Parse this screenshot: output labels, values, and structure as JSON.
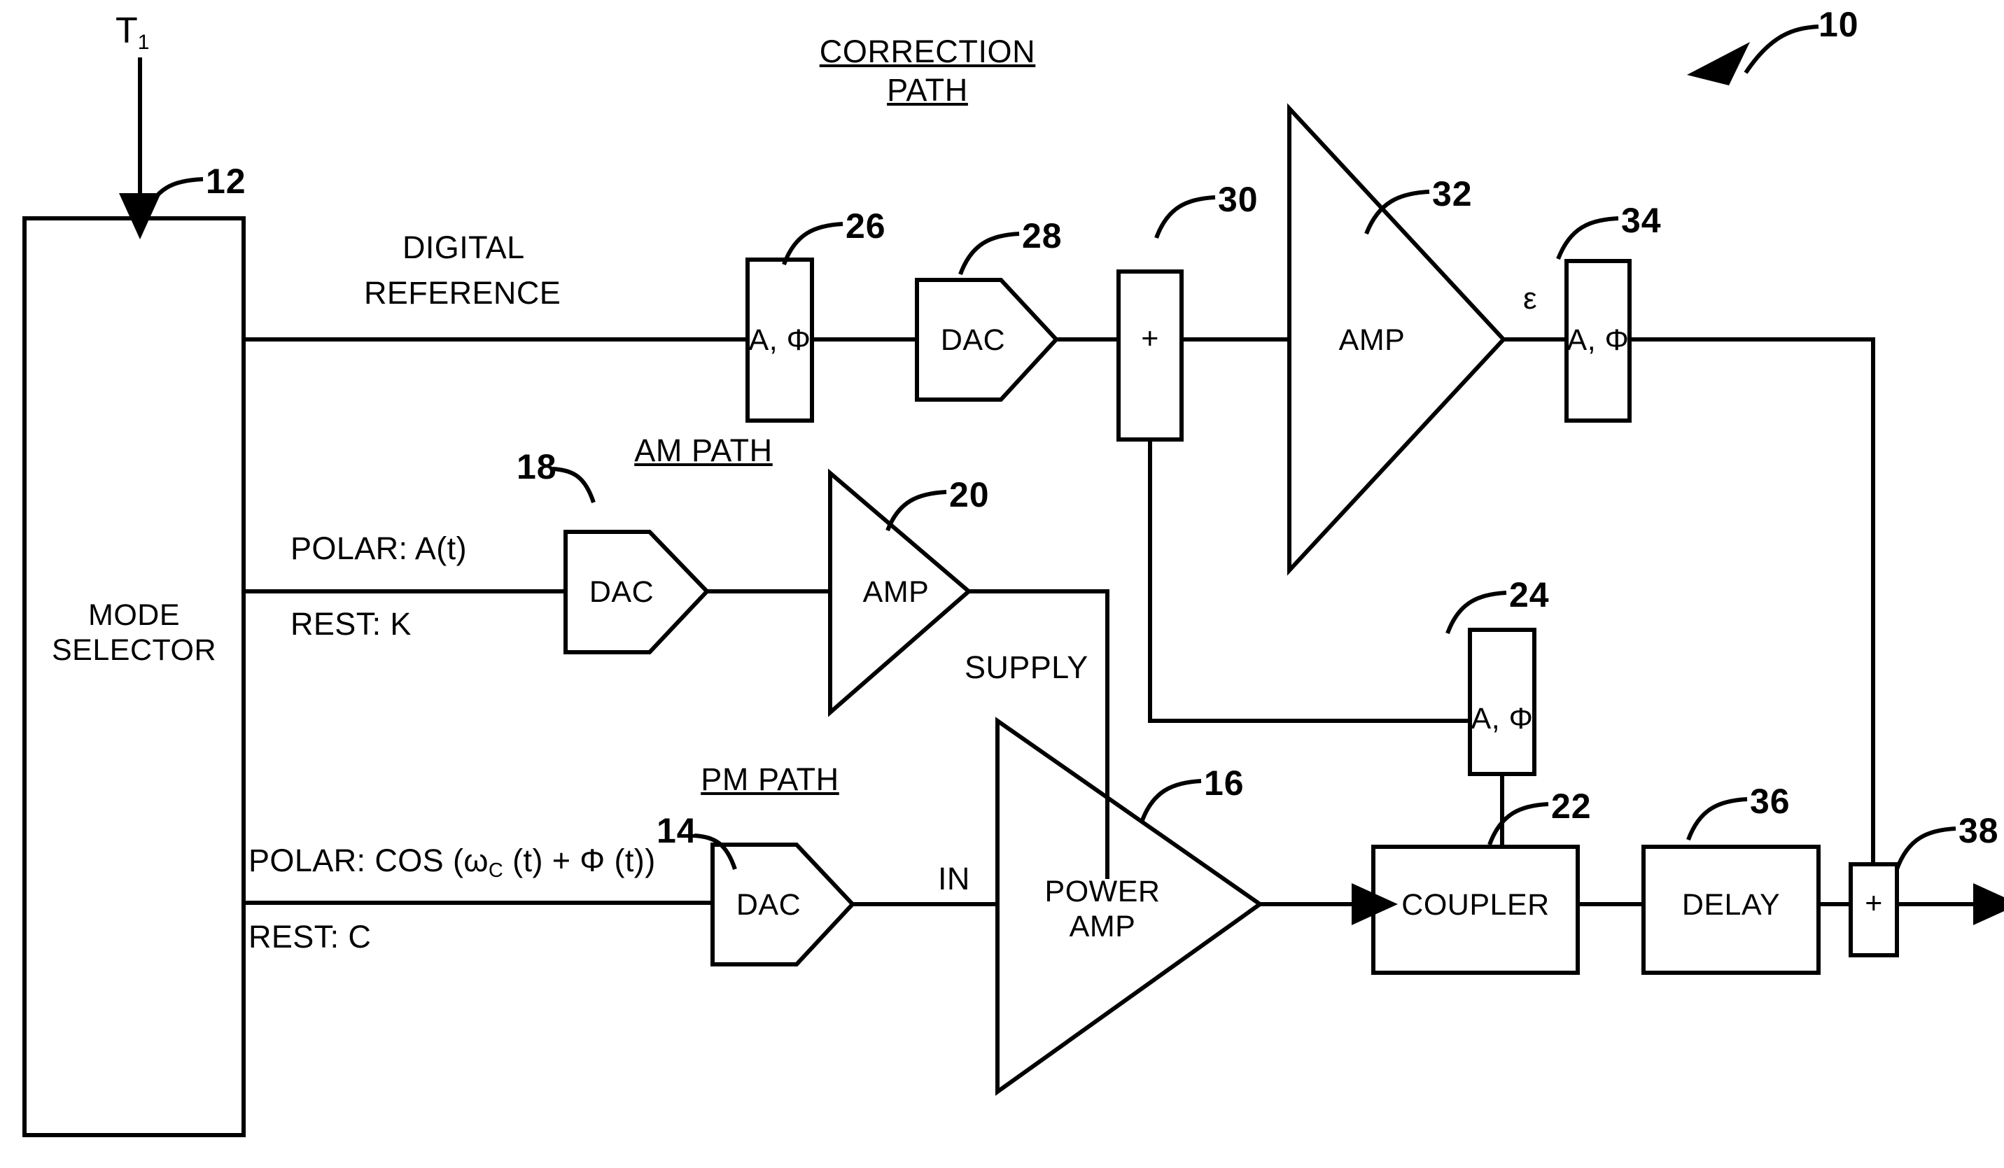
{
  "figure": {
    "reference_number": "10",
    "input_signal_label": "T",
    "input_signal_subscript": "1",
    "headings": {
      "correction_path_line1": "CORRECTION",
      "correction_path_line2": "PATH",
      "am_path": "AM PATH",
      "pm_path": "PM PATH"
    },
    "signal_labels": {
      "digital_reference_line1": "DIGITAL",
      "digital_reference_line2": "REFERENCE",
      "am_polar": "POLAR: A(t)",
      "am_rest": "REST: K",
      "pm_polar_prefix": "POLAR: COS (ω",
      "pm_polar_sub": "C",
      "pm_polar_suffix": " (t) + Φ (t))",
      "pm_rest": "REST: C",
      "supply": "SUPPLY",
      "power_amp_in": "IN",
      "error": "ε"
    },
    "blocks": [
      {
        "id": "12",
        "name": "mode-selector",
        "shape": "rect",
        "label_line1": "MODE",
        "label_line2": "SELECTOR"
      },
      {
        "id": "26",
        "name": "correction-a-phi",
        "shape": "rect",
        "label_line1": "A, Φ"
      },
      {
        "id": "28",
        "name": "correction-dac",
        "shape": "pentagon",
        "label_line1": "DAC"
      },
      {
        "id": "30",
        "name": "correction-summer",
        "shape": "rect",
        "label_line1": "+"
      },
      {
        "id": "32",
        "name": "correction-amp",
        "shape": "triangle",
        "label_line1": "AMP"
      },
      {
        "id": "34",
        "name": "correction-out-a-phi",
        "shape": "rect",
        "label_line1": "A, Φ"
      },
      {
        "id": "18",
        "name": "am-dac",
        "shape": "pentagon",
        "label_line1": "DAC"
      },
      {
        "id": "20",
        "name": "am-amp",
        "shape": "triangle",
        "label_line1": "AMP"
      },
      {
        "id": "24",
        "name": "feedback-a-phi",
        "shape": "rect",
        "label_line1": "A, Φ"
      },
      {
        "id": "14",
        "name": "pm-dac",
        "shape": "pentagon",
        "label_line1": "DAC"
      },
      {
        "id": "16",
        "name": "power-amp",
        "shape": "triangle",
        "label_line1": "POWER",
        "label_line2": "AMP"
      },
      {
        "id": "22",
        "name": "coupler",
        "shape": "rect",
        "label_line1": "COUPLER"
      },
      {
        "id": "36",
        "name": "delay",
        "shape": "rect",
        "label_line1": "DELAY"
      },
      {
        "id": "38",
        "name": "output-summer",
        "shape": "rect",
        "label_line1": "+"
      }
    ],
    "colors": {
      "ink": "#000000",
      "background": "#ffffff"
    }
  }
}
